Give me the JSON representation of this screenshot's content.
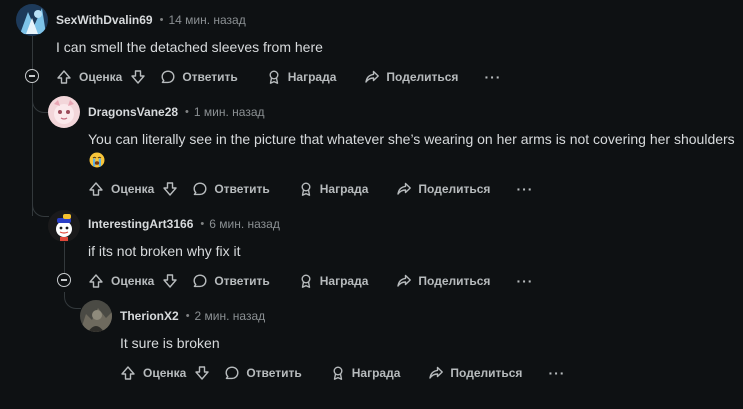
{
  "comments": [
    {
      "author": "SexWithDvalin69",
      "time": "14 мин. назад",
      "text": "I can smell the detached sleeves from here"
    },
    {
      "author": "DragonsVane28",
      "time": "1 мин. назад",
      "text_line1": "You can literally see in the picture that whatever she’s wearing on her arms is not covering her shoulders",
      "emoji": "loudly-crying-face-emoji"
    },
    {
      "author": "InterestingArt3166",
      "time": "6 мин. назад",
      "text": "if its not broken why fix it"
    },
    {
      "author": "TherionX2",
      "time": "2 мин. назад",
      "text": "It sure is broken"
    }
  ],
  "actions": {
    "vote": "Оценка",
    "reply": "Ответить",
    "award": "Награда",
    "share": "Поделиться",
    "more": "···"
  },
  "separator": "•",
  "colors": {
    "background": "#0e1113",
    "thread_line": "#33393c",
    "text": "#d7dadc",
    "muted": "#8b9093"
  }
}
